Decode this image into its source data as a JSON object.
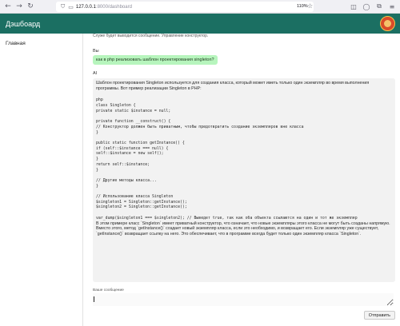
{
  "browser": {
    "url_host": "127.0.0.1",
    "url_path": ":8000/dashboard",
    "zoom": "110%"
  },
  "header": {
    "title": "Дэшбоард"
  },
  "sidebar": {
    "items": [
      {
        "label": "Главная"
      }
    ]
  },
  "chat": {
    "prev_fragment": "Служе будет выводится сообщение. Управление конструктор.",
    "user_role": "Вы",
    "user_message": "как в php реализовать шаблон проектирования singleton?",
    "ai_role": "AI",
    "ai_intro": "Шаблон проектирования Singleton используется для создания класса, который может иметь только один экземпляр во время выполнения программы. Вот пример реализации Singleton в PHP:",
    "ai_code": "php\nclass Singleton {\nprivate static $instance = null;\n\nprivate function __construct() {\n// Конструктор должен быть приватным, чтобы предотвратить создание экземпляров вне класса\n}\n\npublic static function getInstance() {\nif (self::$instance === null) {\nself::$instance = new self();\n}\nreturn self::$instance;\n}\n\n// Другие методы класса...\n}\n\n// Использование класса Singleton\n$singleton1 = Singleton::getInstance();\n$singleton2 = Singleton::getInstance();\n\nvar_dump($singleton1 === $singleton2); // Выведет true, так как оба объекта ссылаются на один и тот же экземпляр",
    "ai_outro": "В этом примере класс `Singleton` имеет приватный конструктор, что означает, что новые экземпляры этого класса не могут быть созданы напрямую. Вместо этого, метод `getInstance()` создает новый экземпляр класса, если это необходимо, и возвращает его. Если экземпляр уже существует, `getInstance()` возвращает ссылку на него. Это обеспечивает, что в программе всегда будет только один экземпляр класса `Singleton`."
  },
  "compose": {
    "label": "Ваше сообщение",
    "value": "",
    "send_label": "Отправить"
  },
  "colors": {
    "header_bg": "#1b6f62",
    "user_bubble": "#b7f5bd",
    "ai_card": "#f2f2f2"
  }
}
